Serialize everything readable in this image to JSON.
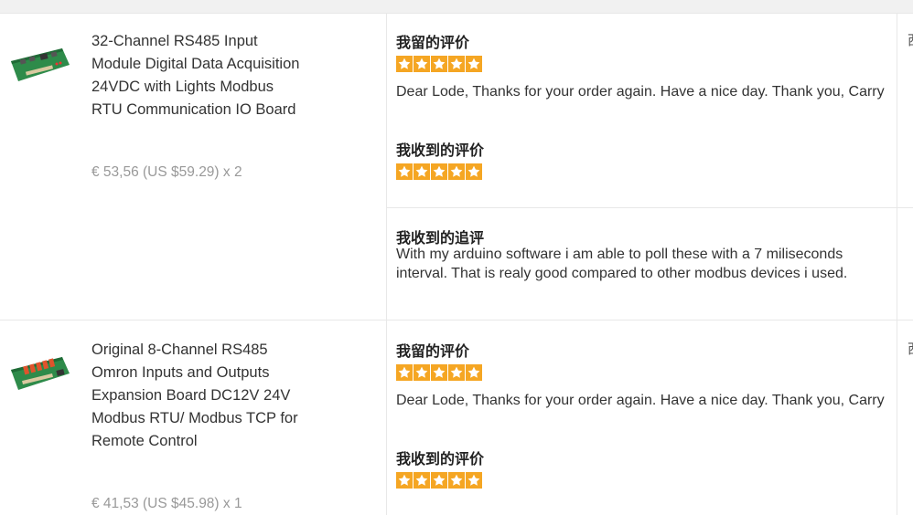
{
  "colors": {
    "star": "#f5a623",
    "price": "#999999",
    "divider": "#e8e8e8"
  },
  "orders": [
    {
      "title": "32-Channel RS485 Input Module Digital Data Acquisition 24VDC with Lights Modbus RTU Communication IO Board",
      "price": "€ 53,56 (US $59.29) x 2",
      "thumb_icon": "circuit-board-image",
      "my_review_label": "我留的评价",
      "my_review_stars": 5,
      "my_review_text": "Dear Lode, Thanks for your order again. Have a nice day. Thank you, Carry",
      "received_review_label": "我收到的评价",
      "received_review_stars": 5,
      "followup_label": "我收到的追评",
      "followup_text": "With my arduino software i am able to poll these with a 7 miliseconds interval. That is realy good compared to other modbus devices i used."
    },
    {
      "title": "Original 8-Channel RS485 Omron Inputs and Outputs Expansion Board DC12V 24V Modbus RTU/ Modbus TCP for Remote Control",
      "price": "€ 41,53 (US $45.98) x 1",
      "thumb_icon": "relay-board-image",
      "my_review_label": "我留的评价",
      "my_review_stars": 5,
      "my_review_text": "Dear Lode, Thanks for your order again. Have a nice day. Thank you, Carry",
      "received_review_label": "我收到的评价",
      "received_review_stars": 5
    }
  ],
  "side_column_char": "西"
}
